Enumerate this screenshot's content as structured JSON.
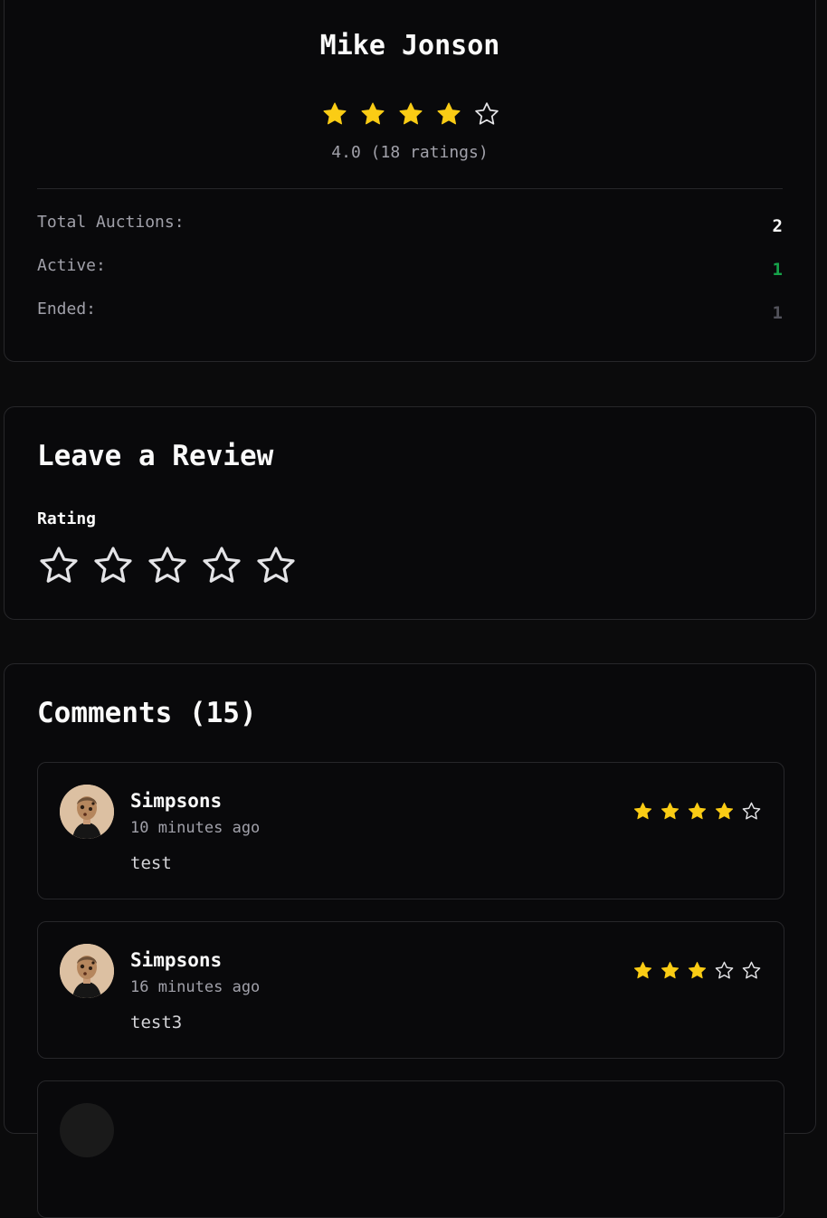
{
  "profile": {
    "name": "Mike Jonson",
    "rating": 4,
    "rating_summary": "4.0 (18 ratings)",
    "stats": [
      {
        "label": "Total Auctions:",
        "value": "2",
        "color": "#fafafa"
      },
      {
        "label": "Active:",
        "value": "1",
        "color": "#16a34a"
      },
      {
        "label": "Ended:",
        "value": "1",
        "color": "#52525b"
      }
    ]
  },
  "review": {
    "title": "Leave a Review",
    "rating_label": "Rating",
    "rating": 0
  },
  "comments": {
    "title": "Comments (15)",
    "items": [
      {
        "user": "Simpsons",
        "time": "10 minutes ago",
        "text": "test",
        "rating": 4
      },
      {
        "user": "Simpsons",
        "time": "16 minutes ago",
        "text": "test3",
        "rating": 3
      },
      {
        "user": "",
        "time": "",
        "text": "",
        "rating": 0
      }
    ]
  },
  "colors": {
    "star_filled": "#facc15",
    "star_empty_stroke": "#e4e4e7",
    "card_border": "#27272a"
  },
  "icons": {
    "star": "star-icon",
    "avatar": "avatar-image"
  }
}
